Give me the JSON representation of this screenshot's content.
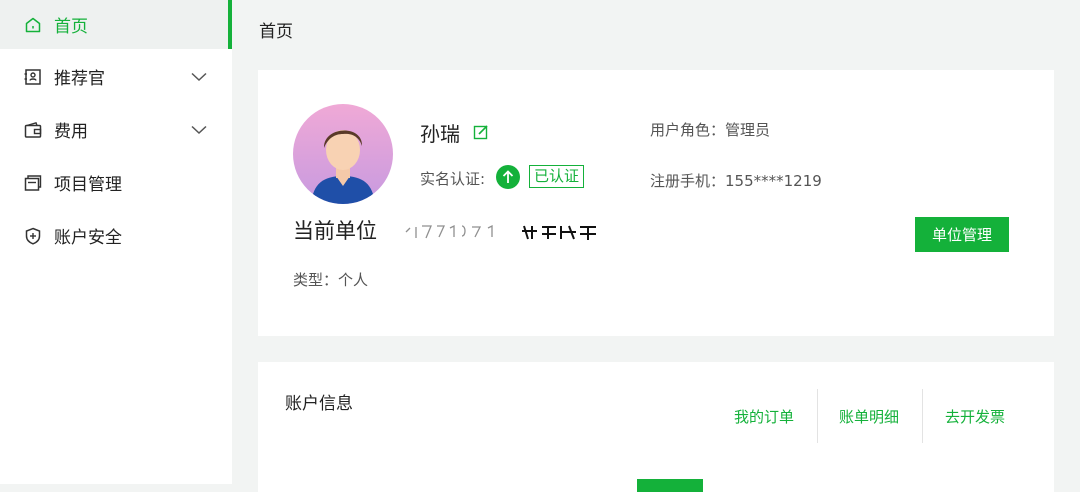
{
  "sidebar": {
    "items": [
      {
        "label": "首页",
        "icon": "home-icon"
      },
      {
        "label": "推荐官",
        "icon": "referrer-icon"
      },
      {
        "label": "费用",
        "icon": "wallet-icon"
      },
      {
        "label": "项目管理",
        "icon": "projects-icon"
      },
      {
        "label": "账户安全",
        "icon": "shield-icon"
      }
    ]
  },
  "breadcrumb": "首页",
  "profile": {
    "name": "孙瑞",
    "verify_label": "实名认证:",
    "verify_status": "已认证",
    "role": "用户角色：管理员",
    "phone": "注册手机：155****1219",
    "current_unit": "当前单位",
    "unit_type": "类型：个人",
    "unit_button": "单位管理"
  },
  "account": {
    "title": "账户信息",
    "links": [
      "我的订单",
      "账单明细",
      "去开发票"
    ]
  },
  "colors": {
    "accent": "#14b13a",
    "background": "#f2f4f3"
  }
}
